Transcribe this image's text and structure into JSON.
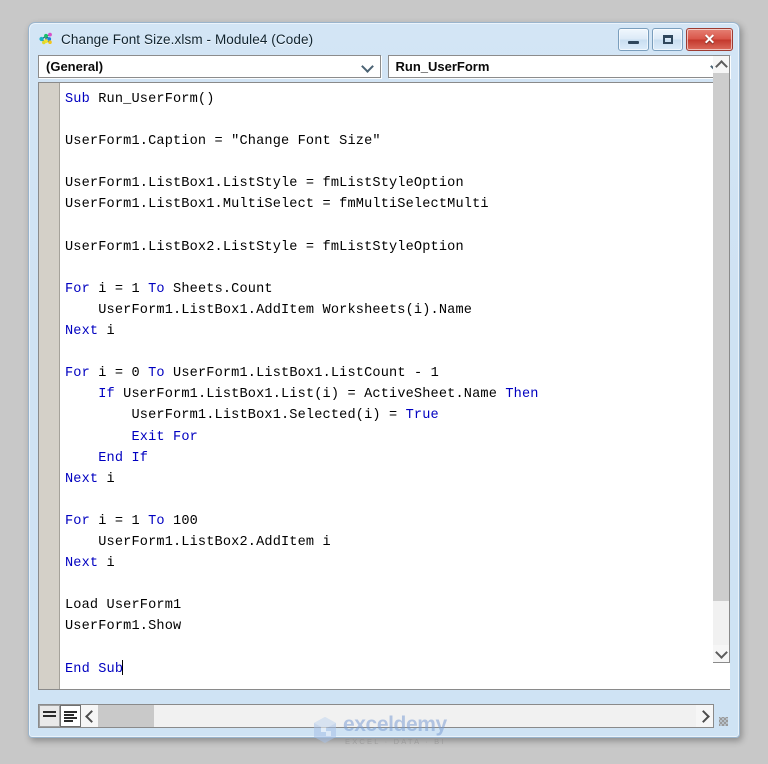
{
  "window": {
    "title": "Change Font Size.xlsm - Module4 (Code)",
    "icon": "vba-module-icon",
    "buttons": {
      "minimize": "minimize-button",
      "maximize": "maximize-button",
      "close": "close-button",
      "close_glyph": "✕"
    }
  },
  "toolbar": {
    "object_combo": {
      "value": "(General)",
      "icon": "chevron-down-icon"
    },
    "procedure_combo": {
      "value": "Run_UserForm",
      "icon": "chevron-down-icon"
    }
  },
  "editor": {
    "lines": [
      [
        {
          "t": "Sub ",
          "k": true
        },
        {
          "t": "Run_UserForm()",
          "k": false
        }
      ],
      [],
      [
        {
          "t": "UserForm1.Caption = \"Change Font Size\"",
          "k": false
        }
      ],
      [],
      [
        {
          "t": "UserForm1.ListBox1.ListStyle = fmListStyleOption",
          "k": false
        }
      ],
      [
        {
          "t": "UserForm1.ListBox1.MultiSelect = fmMultiSelectMulti",
          "k": false
        }
      ],
      [],
      [
        {
          "t": "UserForm1.ListBox2.ListStyle = fmListStyleOption",
          "k": false
        }
      ],
      [],
      [
        {
          "t": "For ",
          "k": true
        },
        {
          "t": "i = 1 ",
          "k": false
        },
        {
          "t": "To ",
          "k": true
        },
        {
          "t": "Sheets.Count",
          "k": false
        }
      ],
      [
        {
          "t": "    UserForm1.ListBox1.AddItem Worksheets(i).Name",
          "k": false
        }
      ],
      [
        {
          "t": "Next ",
          "k": true
        },
        {
          "t": "i",
          "k": false
        }
      ],
      [],
      [
        {
          "t": "For ",
          "k": true
        },
        {
          "t": "i = 0 ",
          "k": false
        },
        {
          "t": "To ",
          "k": true
        },
        {
          "t": "UserForm1.ListBox1.ListCount - 1",
          "k": false
        }
      ],
      [
        {
          "t": "    ",
          "k": false
        },
        {
          "t": "If ",
          "k": true
        },
        {
          "t": "UserForm1.ListBox1.List(i) = ActiveSheet.Name ",
          "k": false
        },
        {
          "t": "Then",
          "k": true
        }
      ],
      [
        {
          "t": "        UserForm1.ListBox1.Selected(i) = ",
          "k": false
        },
        {
          "t": "True",
          "k": true
        }
      ],
      [
        {
          "t": "        ",
          "k": false
        },
        {
          "t": "Exit For",
          "k": true
        }
      ],
      [
        {
          "t": "    ",
          "k": false
        },
        {
          "t": "End If",
          "k": true
        }
      ],
      [
        {
          "t": "Next ",
          "k": true
        },
        {
          "t": "i",
          "k": false
        }
      ],
      [],
      [
        {
          "t": "For ",
          "k": true
        },
        {
          "t": "i = 1 ",
          "k": false
        },
        {
          "t": "To ",
          "k": true
        },
        {
          "t": "100",
          "k": false
        }
      ],
      [
        {
          "t": "    UserForm1.ListBox2.AddItem i",
          "k": false
        }
      ],
      [
        {
          "t": "Next ",
          "k": true
        },
        {
          "t": "i",
          "k": false
        }
      ],
      [],
      [
        {
          "t": "Load UserForm1",
          "k": false
        }
      ],
      [
        {
          "t": "UserForm1.Show",
          "k": false
        }
      ],
      [],
      [
        {
          "t": "End Sub",
          "k": true
        },
        {
          "t": "",
          "k": false,
          "caret": true
        }
      ]
    ]
  },
  "view_buttons": {
    "procedure_view": "procedure-view-button",
    "full_module_view": "full-module-view-button",
    "active": "full_module_view"
  },
  "scrollbars": {
    "vertical": {
      "up": "scroll-up-arrow",
      "down": "scroll-down-arrow"
    },
    "horizontal": {
      "left": "scroll-left-arrow",
      "right": "scroll-right-arrow"
    }
  },
  "watermark": {
    "name": "exceldemy",
    "tagline": "EXCEL · DATA · BI",
    "color": "#7d9fd4"
  },
  "colors": {
    "keyword": "#0000c0",
    "code_text": "#000000",
    "window_frame": "#cfe2f3",
    "desktop": "#c8c8c8",
    "close_button": "#c4382c"
  }
}
